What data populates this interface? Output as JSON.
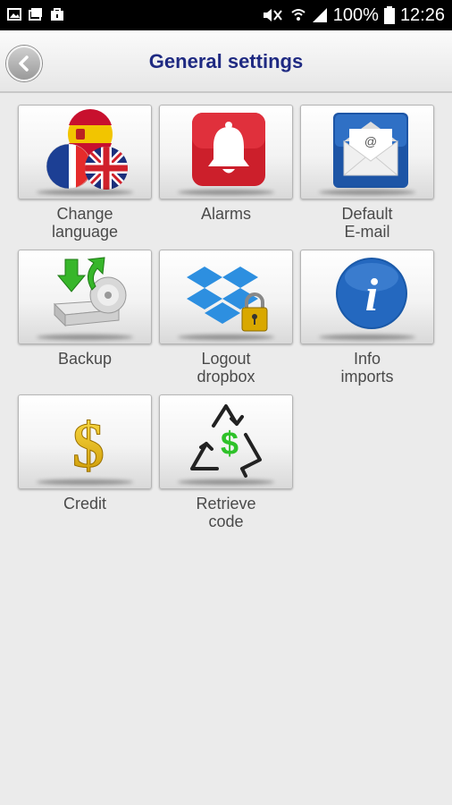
{
  "status_bar": {
    "battery": "100%",
    "time": "12:26"
  },
  "header": {
    "title": "General settings"
  },
  "tiles": [
    {
      "label": "Change\nlanguage",
      "icon": "flags-icon"
    },
    {
      "label": "Alarms",
      "icon": "bell-icon"
    },
    {
      "label": "Default\nE-mail",
      "icon": "envelope-icon"
    },
    {
      "label": "Backup",
      "icon": "backup-drive-icon"
    },
    {
      "label": "Logout\ndropbox",
      "icon": "dropbox-lock-icon"
    },
    {
      "label": "Info\nimports",
      "icon": "info-icon"
    },
    {
      "label": "Credit",
      "icon": "dollar-icon"
    },
    {
      "label": "Retrieve\ncode",
      "icon": "recycle-dollar-icon"
    }
  ]
}
